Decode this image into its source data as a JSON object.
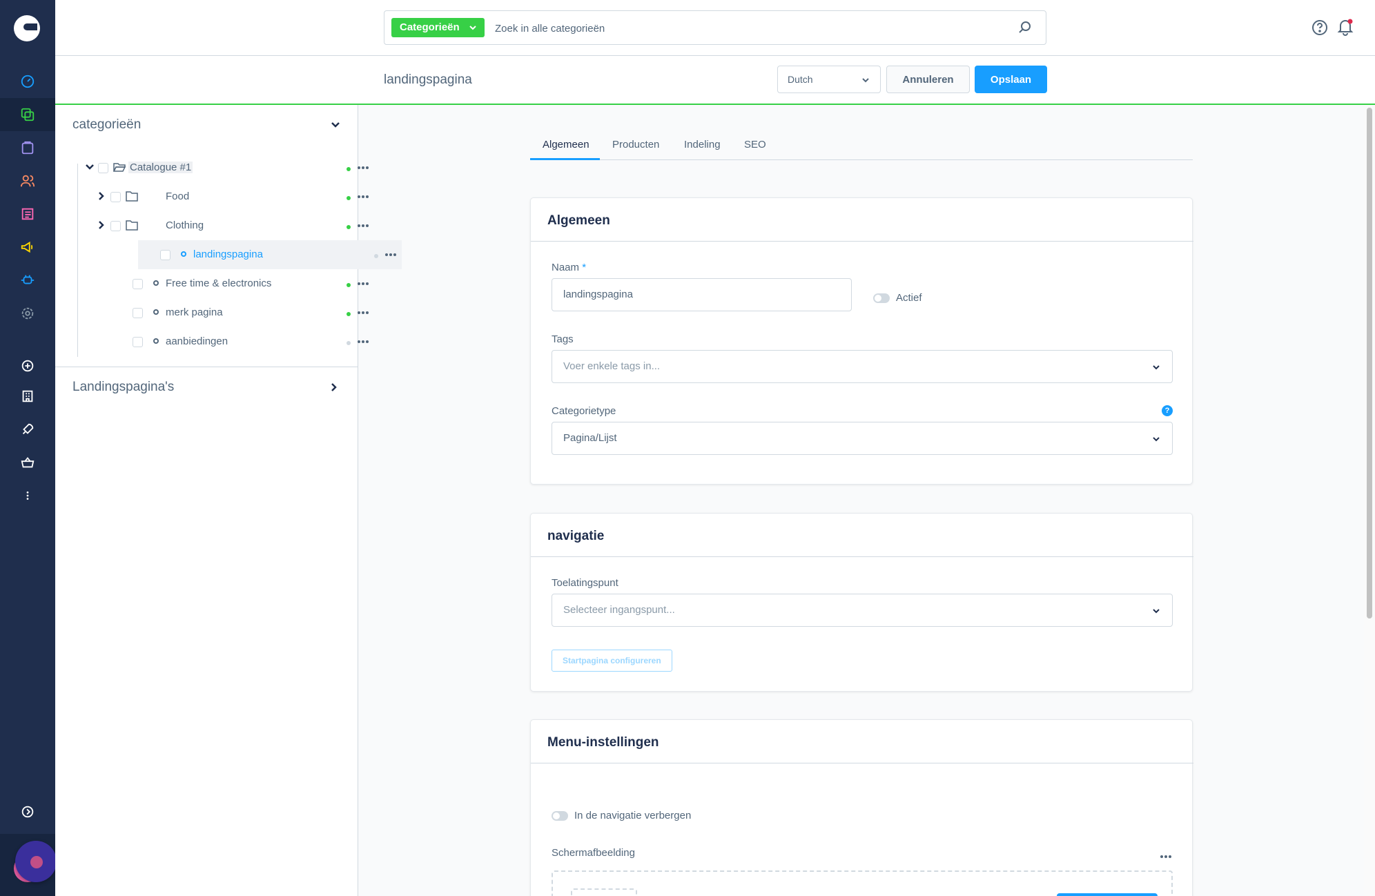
{
  "search": {
    "type_label": "Categorieën",
    "placeholder": "Zoek in alle categorieën"
  },
  "smartbar": {
    "title": "landingspagina",
    "language": "Dutch",
    "cancel_label": "Annuleren",
    "save_label": "Opslaan"
  },
  "tree": {
    "title": "categorieën",
    "items": [
      {
        "label": "Catalogue #1",
        "type": "folder-open",
        "level": 0,
        "active_status": true
      },
      {
        "label": "Food",
        "type": "folder",
        "level": 1,
        "active_status": true
      },
      {
        "label": "Clothing",
        "type": "folder",
        "level": 1,
        "active_status": true
      },
      {
        "label": "landingspagina",
        "type": "leaf",
        "level": 1,
        "active_status": false,
        "selected": true
      },
      {
        "label": "Free time & electronics",
        "type": "leaf",
        "level": 1,
        "active_status": true
      },
      {
        "label": "merk pagina",
        "type": "leaf",
        "level": 1,
        "active_status": true
      },
      {
        "label": "aanbiedingen",
        "type": "leaf",
        "level": 1,
        "active_status": false
      }
    ],
    "landing_title": "Landingspagina's"
  },
  "tabs": [
    {
      "label": "Algemeen",
      "active": true
    },
    {
      "label": "Producten",
      "active": false
    },
    {
      "label": "Indeling",
      "active": false
    },
    {
      "label": "SEO",
      "active": false
    }
  ],
  "general_card": {
    "title": "Algemeen",
    "name_label": "Naam",
    "name_required": "*",
    "name_value": "landingspagina",
    "active_label": "Actief",
    "tags_label": "Tags",
    "tags_placeholder": "Voer enkele tags in...",
    "category_type_label": "Categorietype",
    "category_type_value": "Pagina/Lijst",
    "help_glyph": "?"
  },
  "navigation_card": {
    "title": "navigatie",
    "entry_label": "Toelatingspunt",
    "entry_placeholder": "Selecteer ingangspunt...",
    "configure_label": "Startpagina configureren"
  },
  "menu_card": {
    "title": "Menu-instellingen",
    "hide_label": "In de navigatie verbergen",
    "image_label": "Schermafbeelding"
  },
  "colors": {
    "sidebar_bg": "#1f2e4d",
    "primary": "#189eff",
    "success": "#37d046"
  },
  "sidenav_icons": [
    "dashboard-icon",
    "catalog-icon",
    "orders-icon",
    "customers-icon",
    "content-icon",
    "marketing-icon",
    "extensions-icon",
    "settings-icon",
    "add-icon",
    "store-icon",
    "rocket-icon",
    "basket-icon",
    "more-icon",
    "expand-icon"
  ]
}
